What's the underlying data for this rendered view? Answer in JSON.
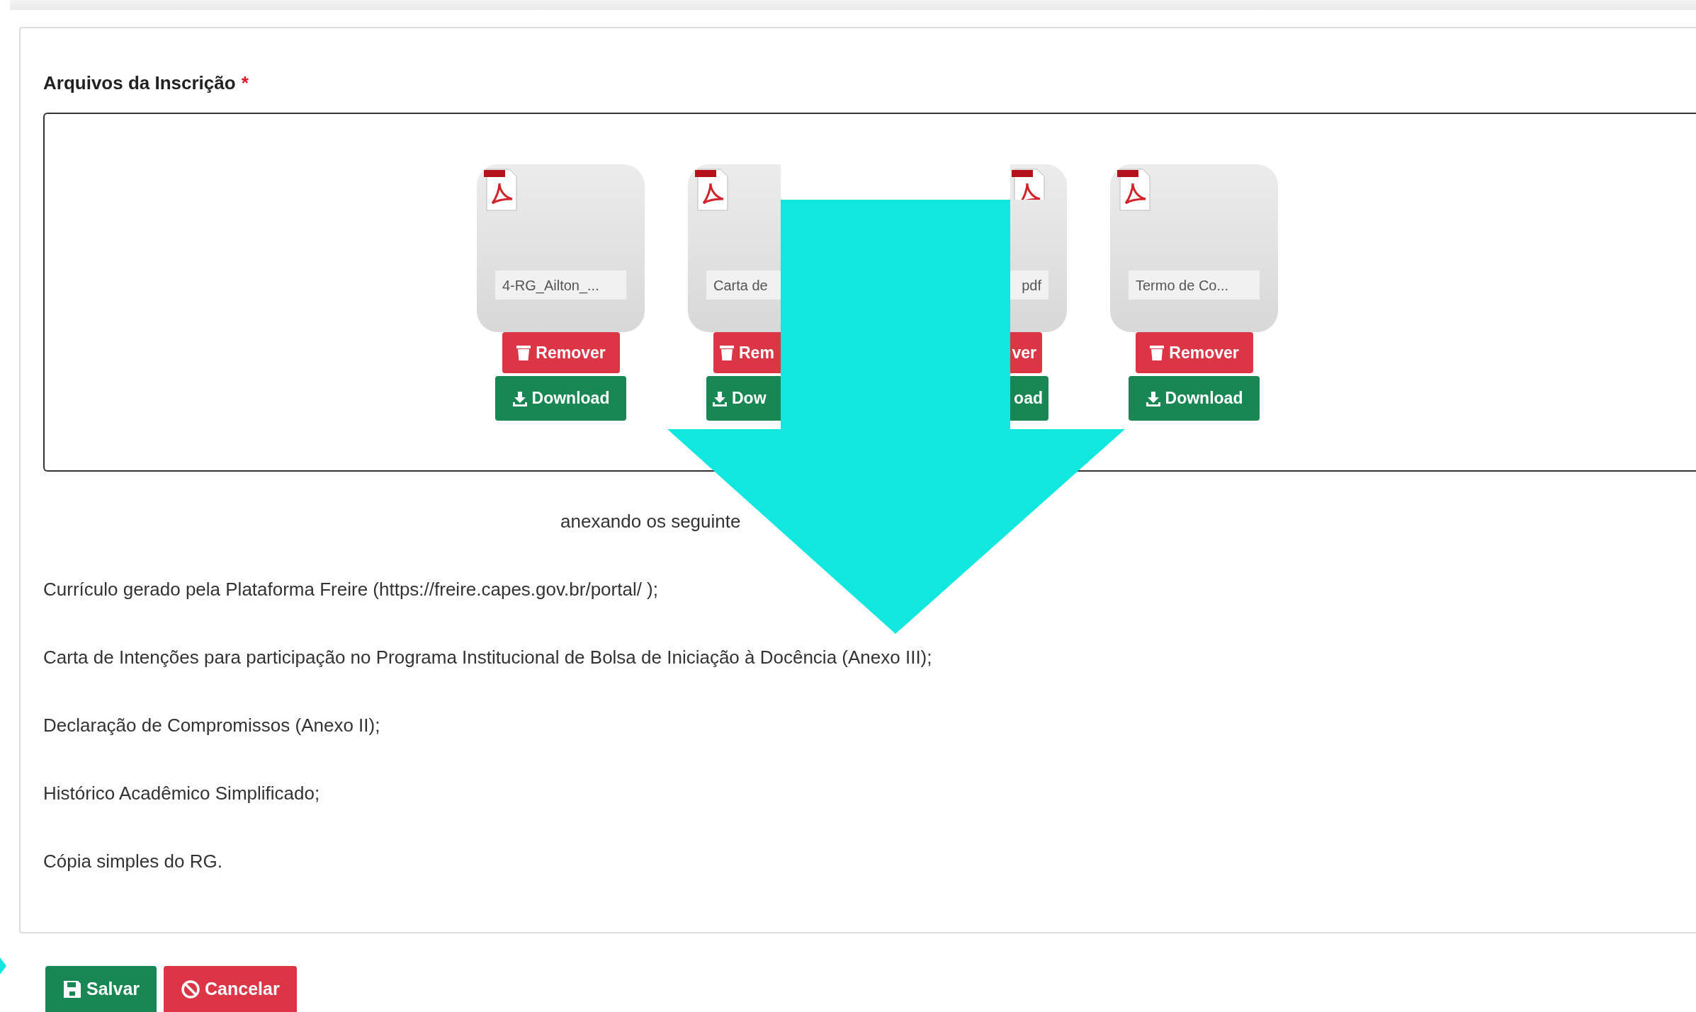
{
  "section": {
    "title": "Arquivos da Inscrição",
    "required_mark": "*"
  },
  "files": [
    {
      "name": "4-RG_Ailton_...",
      "buttons": [
        {
          "kind": "remove",
          "label": "Remover"
        },
        {
          "kind": "download",
          "label": "Download"
        }
      ]
    },
    {
      "name": "Carta de",
      "buttons": [
        {
          "kind": "remove",
          "label": "Rem"
        },
        {
          "kind": "download",
          "label": "Dow"
        }
      ]
    },
    {
      "name": "pdf",
      "buttons": [
        {
          "kind": "remove",
          "label": "ver"
        },
        {
          "kind": "download",
          "label": "oad"
        }
      ]
    },
    {
      "name": "Termo de Co...",
      "buttons": [
        {
          "kind": "remove",
          "label": "Remover"
        },
        {
          "kind": "download",
          "label": "Download"
        }
      ]
    }
  ],
  "requirements": {
    "intro": "anexando os seguinte",
    "items": [
      "Currículo gerado pela Plataforma Freire (https://freire.capes.gov.br/portal/ );",
      "Carta de Intenções para participação no Programa Institucional de Bolsa de Iniciação à Docência (Anexo III);",
      "Declaração de Compromissos (Anexo II);",
      "Histórico Acadêmico Simplificado;",
      "Cópia simples do RG."
    ]
  },
  "actions": [
    {
      "kind": "save",
      "label": "Salvar"
    },
    {
      "kind": "cancel",
      "label": "Cancelar"
    }
  ]
}
